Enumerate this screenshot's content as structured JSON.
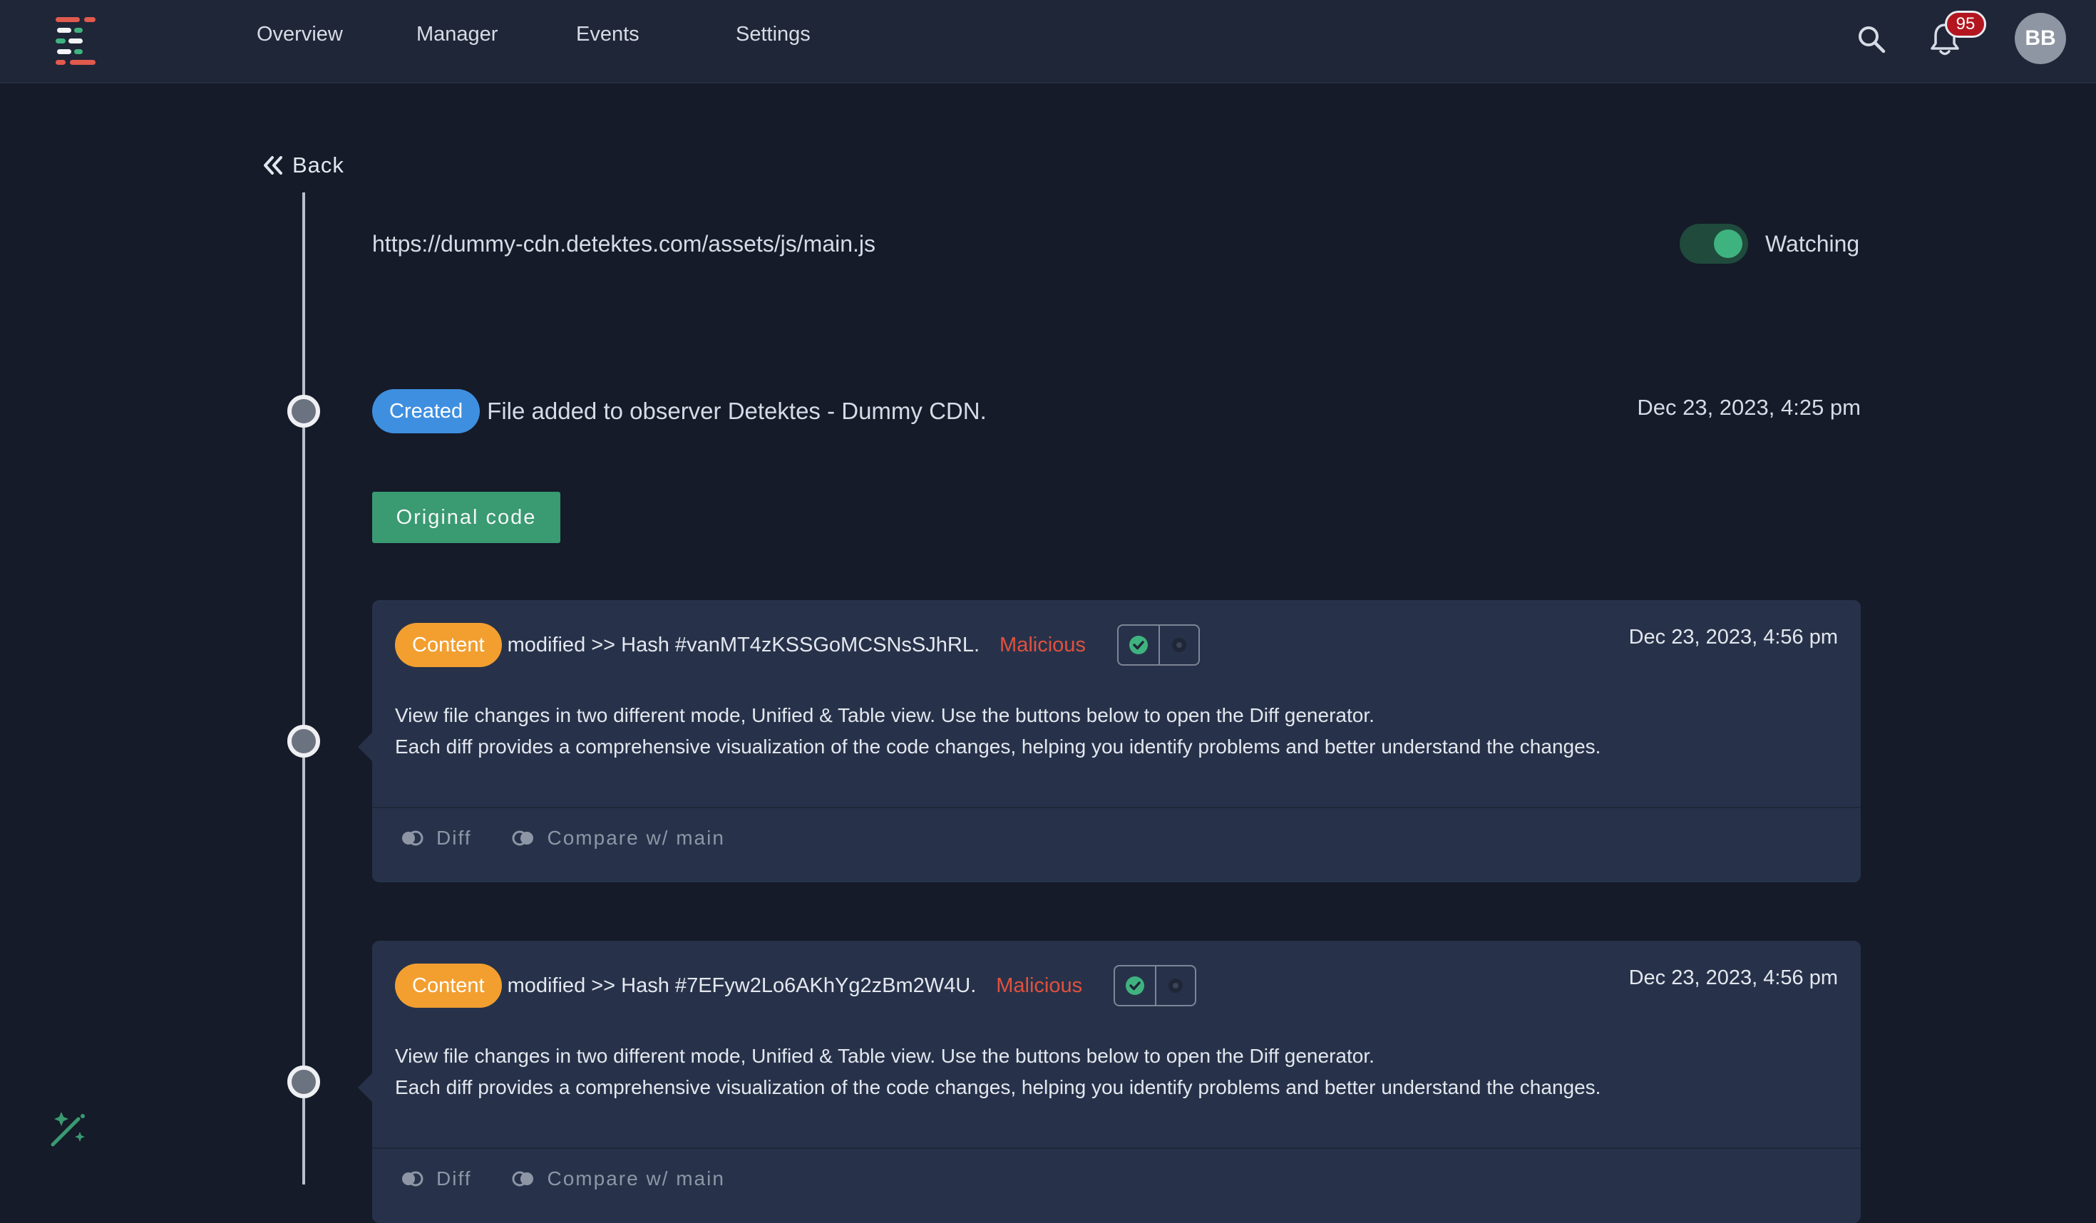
{
  "nav": {
    "items": [
      "Overview",
      "Manager",
      "Events",
      "Settings"
    ],
    "notification_count": "95",
    "avatar_initials": "BB"
  },
  "page": {
    "back_label": "Back",
    "file_url": "https://dummy-cdn.detektes.com/assets/js/main.js",
    "watch_toggle_on": true,
    "watch_label": "Watching"
  },
  "created_event": {
    "badge": "Created",
    "text": "File added to observer Detektes - Dummy CDN.",
    "date": "Dec 23, 2023, 4:25 pm",
    "original_code_label": "Original code"
  },
  "events": [
    {
      "badge": "Content",
      "title": "modified >> Hash #vanMT4zKSSGoMCSNsSJhRL.",
      "verdict": "Malicious",
      "date": "Dec 23, 2023, 4:56 pm",
      "body_line1": "View file changes in two different mode, Unified & Table view. Use the buttons below to open the Diff generator.",
      "body_line2": "Each diff provides a comprehensive visualization of the code changes, helping you identify problems and better understand the changes.",
      "action_diff": "Diff",
      "action_compare": "Compare w/ main"
    },
    {
      "badge": "Content",
      "title": "modified >> Hash #7EFyw2Lo6AKhYg2zBm2W4U.",
      "verdict": "Malicious",
      "date": "Dec 23, 2023, 4:56 pm",
      "body_line1": "View file changes in two different mode, Unified & Table view. Use the buttons below to open the Diff generator.",
      "body_line2": "Each diff provides a comprehensive visualization of the code changes, helping you identify problems and better understand the changes.",
      "action_diff": "Diff",
      "action_compare": "Compare w/ main"
    }
  ],
  "colors": {
    "background": "#151b28",
    "topbar": "#1f2637",
    "card": "#27324a",
    "accent_green": "#3a9a72",
    "badge_blue": "#3f8fe0",
    "badge_orange": "#f29f30",
    "malicious_red": "#e1513e"
  },
  "icons": {
    "logo": "detektes-logo-icon",
    "search": "search-icon",
    "bell": "bell-icon",
    "back": "double-chevron-left-icon",
    "approve": "check-badge-icon",
    "reject": "gear-badge-icon",
    "diff": "toggle-circles-icon",
    "theme": "magic-wand-icon"
  }
}
